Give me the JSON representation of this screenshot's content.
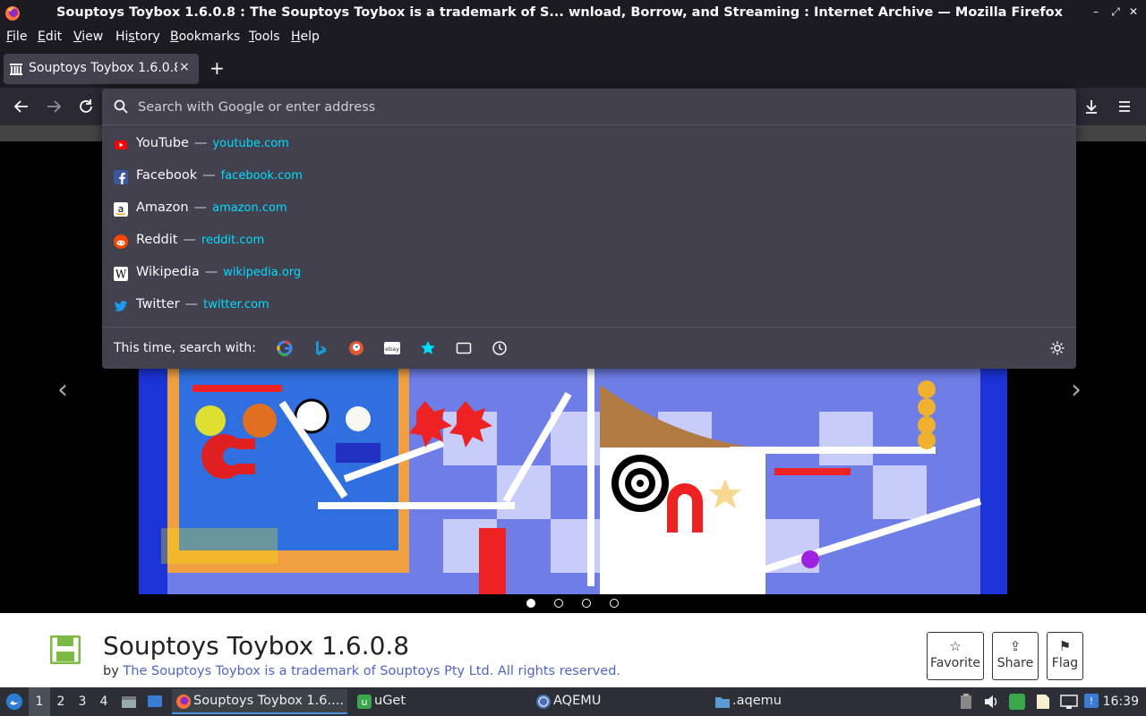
{
  "window": {
    "title": "Souptoys Toybox 1.6.0.8 : The Souptoys Toybox is a trademark of S...  wnload, Borrow, and Streaming : Internet Archive — Mozilla Firefox"
  },
  "menubar": {
    "items": [
      {
        "pre": "",
        "u": "F",
        "post": "ile"
      },
      {
        "pre": "",
        "u": "E",
        "post": "dit"
      },
      {
        "pre": "",
        "u": "V",
        "post": "iew"
      },
      {
        "pre": "Hi",
        "u": "s",
        "post": "tory"
      },
      {
        "pre": "",
        "u": "B",
        "post": "ookmarks"
      },
      {
        "pre": "",
        "u": "T",
        "post": "ools"
      },
      {
        "pre": "",
        "u": "H",
        "post": "elp"
      }
    ]
  },
  "tab": {
    "title": "Souptoys Toybox 1.6.0.8",
    "close_glyph": "×",
    "new_tab_glyph": "+"
  },
  "urlbar": {
    "placeholder": "Search with Google or enter address",
    "suggestions": [
      {
        "title": "YouTube",
        "sep": "—",
        "url": "youtube.com",
        "icon": "youtube-icon",
        "color": "#ff0000"
      },
      {
        "title": "Facebook",
        "sep": "—",
        "url": "facebook.com",
        "icon": "facebook-icon",
        "color": "#3b5998"
      },
      {
        "title": "Amazon",
        "sep": "—",
        "url": "amazon.com",
        "icon": "amazon-icon",
        "color": "#ffffff"
      },
      {
        "title": "Reddit",
        "sep": "—",
        "url": "reddit.com",
        "icon": "reddit-icon",
        "color": "#ff4500"
      },
      {
        "title": "Wikipedia",
        "sep": "—",
        "url": "wikipedia.org",
        "icon": "wikipedia-icon",
        "color": "#ffffff"
      },
      {
        "title": "Twitter",
        "sep": "—",
        "url": "twitter.com",
        "icon": "twitter-icon",
        "color": "#1d9bf0"
      }
    ],
    "oneoff_label": "This time, search with:",
    "oneoff_engines": [
      "google-icon",
      "bing-icon",
      "duckduckgo-icon",
      "ebay-icon",
      "bookmarks-star-icon",
      "tabs-icon",
      "history-icon"
    ]
  },
  "carousel": {
    "prev_glyph": "‹",
    "next_glyph": "›",
    "slides": 4,
    "active_slide": 1
  },
  "item": {
    "title": "Souptoys Toybox  1.6.0.8",
    "by_label": "by",
    "creator": "The Souptoys Toybox is a trademark of Souptoys Pty Ltd. All rights reserved.",
    "actions": [
      {
        "label": "Favorite",
        "glyph": "☆",
        "icon": "star-icon"
      },
      {
        "label": "Share",
        "glyph": "⇪",
        "icon": "share-icon"
      },
      {
        "label": "Flag",
        "glyph": "⚑",
        "icon": "flag-icon"
      }
    ],
    "accent": "#7cba45"
  },
  "taskbar": {
    "workspaces": [
      "1",
      "2",
      "3",
      "4"
    ],
    "active_workspace": "1",
    "tasks": [
      {
        "label": "Souptoys Toybox 1.6....",
        "icon": "firefox-icon"
      },
      {
        "label": "uGet",
        "icon": "uget-icon"
      },
      {
        "label": "AQEMU",
        "icon": "aqemu-icon"
      },
      {
        "label": ".aqemu",
        "icon": "folder-icon"
      }
    ],
    "clock": "16:39"
  }
}
